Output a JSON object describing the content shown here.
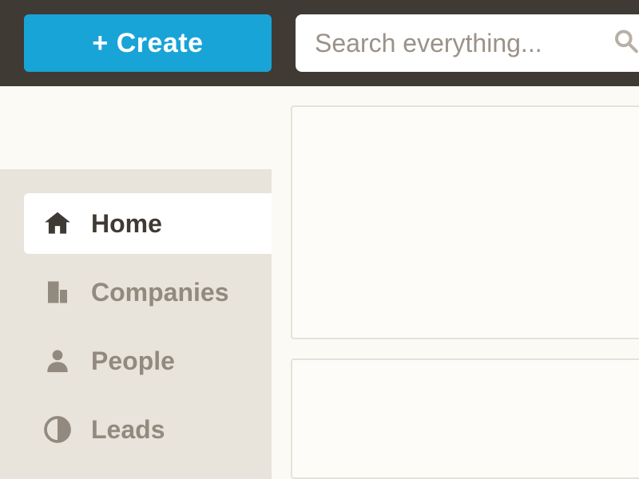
{
  "topbar": {
    "create_label": "+ Create",
    "search_placeholder": "Search everything..."
  },
  "sidebar": {
    "items": [
      {
        "label": "Home",
        "icon": "home-icon",
        "active": true
      },
      {
        "label": "Companies",
        "icon": "companies-icon",
        "active": false
      },
      {
        "label": "People",
        "icon": "people-icon",
        "active": false
      },
      {
        "label": "Leads",
        "icon": "leads-icon",
        "active": false
      }
    ]
  }
}
